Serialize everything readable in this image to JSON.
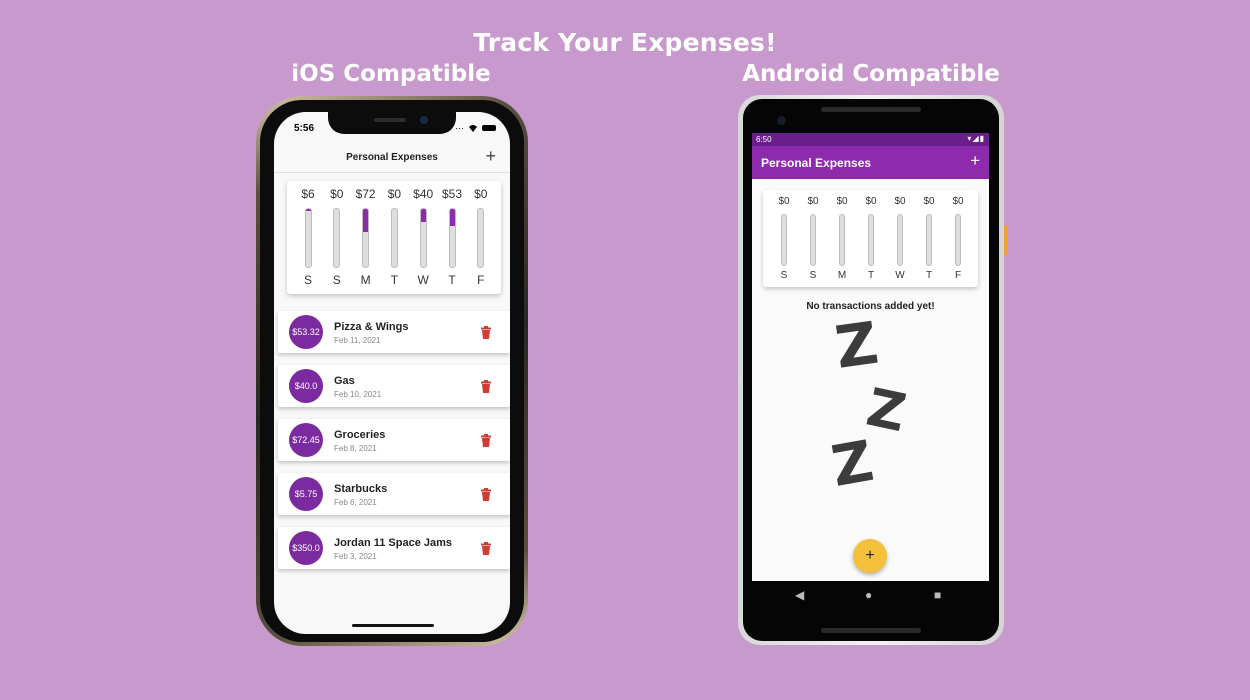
{
  "headline": "Track Your Expenses!",
  "ios": {
    "platform_label": "iOS Compatible",
    "status_time": "5:56",
    "nav_title": "Personal Expenses",
    "add_glyph": "+",
    "chart": {
      "amounts": [
        "$6",
        "$0",
        "$72",
        "$0",
        "$40",
        "$53",
        "$0"
      ],
      "days": [
        "S",
        "S",
        "M",
        "T",
        "W",
        "T",
        "F"
      ],
      "fill_fractions": [
        0.03,
        0,
        0.4,
        0,
        0.22,
        0.29,
        0
      ]
    },
    "transactions": [
      {
        "amount": "$53.32",
        "title": "Pizza & Wings",
        "date": "Feb 11, 2021"
      },
      {
        "amount": "$40.0",
        "title": "Gas",
        "date": "Feb 10, 2021"
      },
      {
        "amount": "$72.45",
        "title": "Groceries",
        "date": "Feb 8, 2021"
      },
      {
        "amount": "$5.75",
        "title": "Starbucks",
        "date": "Feb 6, 2021"
      },
      {
        "amount": "$350.0",
        "title": "Jordan 11 Space Jams",
        "date": "Feb 3, 2021"
      }
    ]
  },
  "android": {
    "platform_label": "Android Compatible",
    "status_time": "6:50",
    "app_title": "Personal Expenses",
    "add_glyph": "+",
    "chart": {
      "amounts": [
        "$0",
        "$0",
        "$0",
        "$0",
        "$0",
        "$0",
        "$0"
      ],
      "days": [
        "S",
        "S",
        "M",
        "T",
        "W",
        "T",
        "F"
      ],
      "fill_fractions": [
        0,
        0,
        0,
        0,
        0,
        0,
        0
      ]
    },
    "empty_message": "No transactions added yet!",
    "zzz": [
      "Z",
      "Z",
      "Z"
    ],
    "fab_glyph": "+",
    "nav_glyphs": {
      "back": "◀",
      "home": "●",
      "recents": "■"
    }
  },
  "colors": {
    "background": "#c899cc",
    "primary": "#8e2bac",
    "avatar": "#7b2aa0",
    "delete": "#d03b36",
    "fab": "#f5c13c"
  }
}
